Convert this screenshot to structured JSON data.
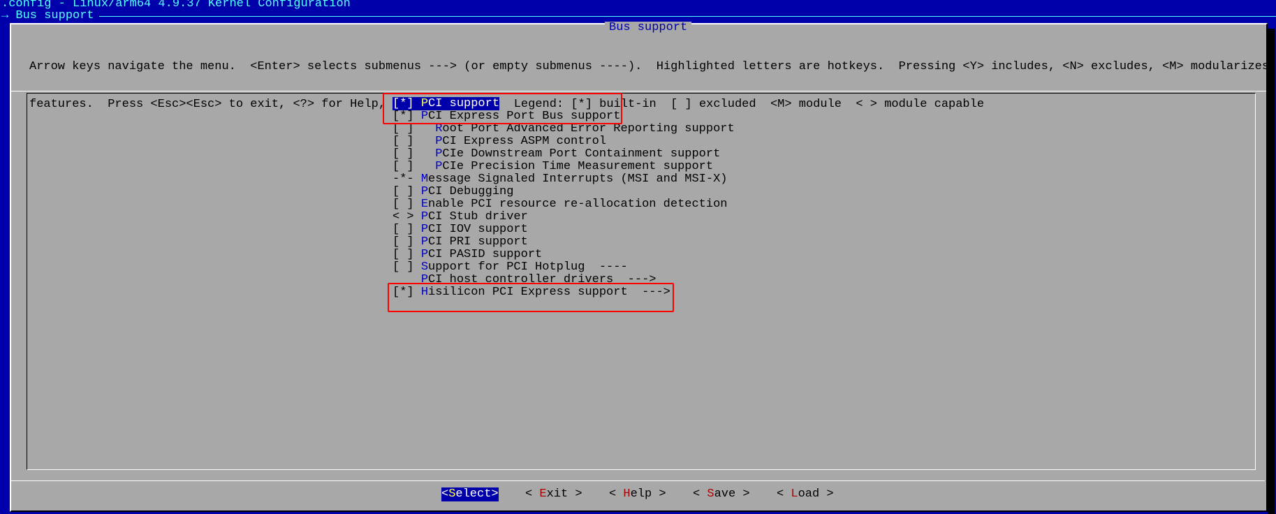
{
  "window": {
    "title": ".config - Linux/arm64 4.9.37 Kernel Configuration",
    "breadcrumb": "→ Bus support"
  },
  "dialog": {
    "title": "Bus support",
    "help_line1": "Arrow keys navigate the menu.  <Enter> selects submenus ---> (or empty submenus ----).  Highlighted letters are hotkeys.  Pressing <Y> includes, <N> excludes, <M> modularizes",
    "help_line2": "features.  Press <Esc><Esc> to exit, <?> for Help, </> for Search.  Legend: [*] built-in  [ ] excluded  <M> module  < > module capable"
  },
  "menu": {
    "items": [
      {
        "state": "[*]",
        "indent": " ",
        "hotkey": "P",
        "rest": "CI support",
        "suffix": "",
        "selected": true
      },
      {
        "state": "[*]",
        "indent": " ",
        "hotkey": "P",
        "rest": "CI Express Port Bus support",
        "suffix": "",
        "selected": false
      },
      {
        "state": "[ ]",
        "indent": "   ",
        "hotkey": "R",
        "rest": "oot Port Advanced Error Reporting support",
        "suffix": "",
        "selected": false
      },
      {
        "state": "[ ]",
        "indent": "   ",
        "hotkey": "P",
        "rest": "CI Express ASPM control",
        "suffix": "",
        "selected": false
      },
      {
        "state": "[ ]",
        "indent": "   ",
        "hotkey": "P",
        "rest": "CIe Downstream Port Containment support",
        "suffix": "",
        "selected": false
      },
      {
        "state": "[ ]",
        "indent": "   ",
        "hotkey": "P",
        "rest": "CIe Precision Time Measurement support",
        "suffix": "",
        "selected": false
      },
      {
        "state": "-*-",
        "indent": " ",
        "hotkey": "M",
        "rest": "essage Signaled Interrupts (MSI and MSI-X)",
        "suffix": "",
        "selected": false
      },
      {
        "state": "[ ]",
        "indent": " ",
        "hotkey": "P",
        "rest": "CI Debugging",
        "suffix": "",
        "selected": false
      },
      {
        "state": "[ ]",
        "indent": " ",
        "hotkey": "E",
        "rest": "nable PCI resource re-allocation detection",
        "suffix": "",
        "selected": false
      },
      {
        "state": "< >",
        "indent": " ",
        "hotkey": "P",
        "rest": "CI Stub driver",
        "suffix": "",
        "selected": false
      },
      {
        "state": "[ ]",
        "indent": " ",
        "hotkey": "P",
        "rest": "CI IOV support",
        "suffix": "",
        "selected": false
      },
      {
        "state": "[ ]",
        "indent": " ",
        "hotkey": "P",
        "rest": "CI PRI support",
        "suffix": "",
        "selected": false
      },
      {
        "state": "[ ]",
        "indent": " ",
        "hotkey": "P",
        "rest": "CI PASID support",
        "suffix": "",
        "selected": false
      },
      {
        "state": "[ ]",
        "indent": " ",
        "hotkey": "S",
        "rest": "upport for PCI Hotplug",
        "suffix": "  ----",
        "selected": false
      },
      {
        "state": "   ",
        "indent": " ",
        "hotkey": "P",
        "rest": "CI host controller drivers",
        "suffix": "  --->",
        "selected": false
      },
      {
        "state": "[*]",
        "indent": " ",
        "hotkey": "H",
        "rest": "isilicon PCI Express support",
        "suffix": "  --->",
        "selected": false
      }
    ]
  },
  "buttons": {
    "select": {
      "pre": "<",
      "hk": "S",
      "rest": "elect>"
    },
    "exit": {
      "pre": "< ",
      "hk": "E",
      "rest": "xit >"
    },
    "help": {
      "pre": "< ",
      "hk": "H",
      "rest": "elp >"
    },
    "save": {
      "pre": "< ",
      "hk": "S",
      "rest": "ave >"
    },
    "load": {
      "pre": "< ",
      "hk": "L",
      "rest": "oad >"
    }
  },
  "colors": {
    "background": "#0000aa",
    "dialog": "#a8a8a8",
    "annotation": "#ff0000",
    "hotkey": "#0000cc"
  }
}
